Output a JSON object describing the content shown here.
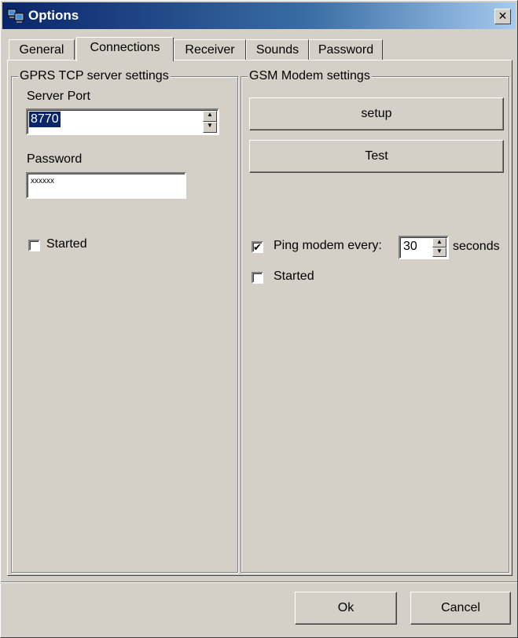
{
  "window": {
    "title": "Options",
    "close_glyph": "✕"
  },
  "tabs": [
    {
      "label": "General"
    },
    {
      "label": "Connections"
    },
    {
      "label": "Receiver"
    },
    {
      "label": "Sounds"
    },
    {
      "label": "Password"
    }
  ],
  "gprs": {
    "title": "GPRS TCP server settings",
    "port_label": "Server Port",
    "port_value": "8770",
    "password_label": "Password",
    "password_value": "xxxxxx",
    "started_label": "Started",
    "started_checked": false
  },
  "gsm": {
    "title": "GSM Modem settings",
    "setup_label": "setup",
    "test_label": "Test",
    "ping_label": "Ping modem every:",
    "ping_checked": true,
    "ping_value": "30",
    "ping_unit": "seconds",
    "started_label": "Started",
    "started_checked": false
  },
  "footer": {
    "ok_label": "Ok",
    "cancel_label": "Cancel"
  },
  "icons": {
    "app": "computer-network-icon",
    "check": "✔",
    "up": "▲",
    "down": "▼"
  },
  "colors": {
    "titlebar": "#0a246a",
    "selection": "#0a246a",
    "face": "#d4d0c8"
  }
}
